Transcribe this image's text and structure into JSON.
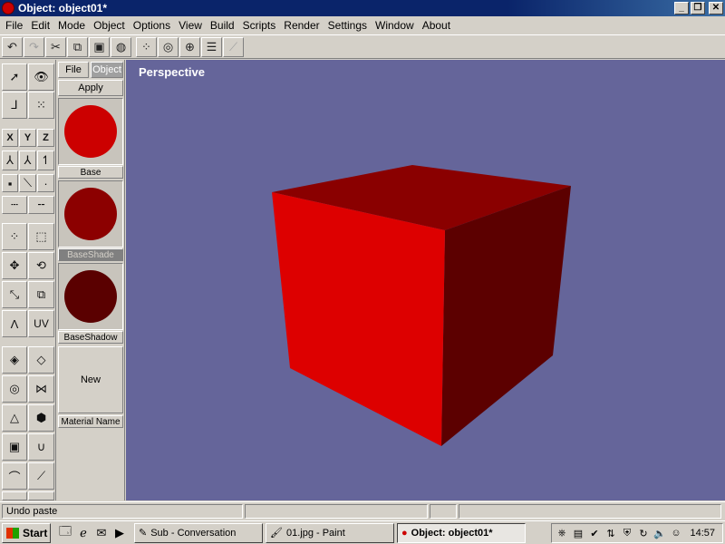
{
  "window": {
    "title": "Object: object01*"
  },
  "menu": [
    "File",
    "Edit",
    "Mode",
    "Object",
    "Options",
    "View",
    "Build",
    "Scripts",
    "Render",
    "Settings",
    "Window",
    "About"
  ],
  "material_panel": {
    "tabs": [
      "File",
      "Object"
    ],
    "apply_label": "Apply",
    "swatches": [
      {
        "label": "Base",
        "color": "#cc0000"
      },
      {
        "label": "BaseShade",
        "color": "#8c0000"
      },
      {
        "label": "BaseShadow",
        "color": "#5a0000"
      }
    ],
    "new_label": "New",
    "material_name_label": "Material Name"
  },
  "left_tools": {
    "axes": [
      "X",
      "Y",
      "Z"
    ],
    "uv_label": "UV"
  },
  "viewport": {
    "label": "Perspective",
    "background": "#65659a",
    "cube_colors": {
      "front": "#dd0000",
      "top": "#8a0000",
      "side": "#5c0000"
    }
  },
  "status": {
    "message": "Undo paste"
  },
  "taskbar": {
    "start_label": "Start",
    "tasks": [
      {
        "label": "Sub - Conversation",
        "active": false
      },
      {
        "label": "01.jpg - Paint",
        "active": false
      },
      {
        "label": "Object: object01*",
        "active": true
      }
    ],
    "clock": "14:57"
  }
}
